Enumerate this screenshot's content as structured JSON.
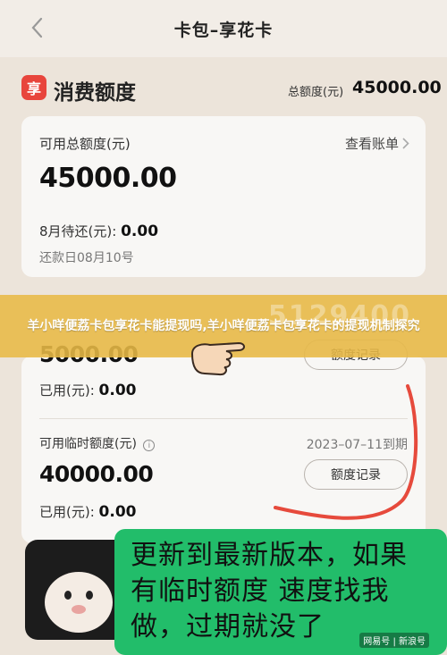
{
  "header": {
    "title": "卡包–享花卡"
  },
  "summary": {
    "brand_glyph": "享",
    "brand_title": "消费额度",
    "total_label": "总额度(元)",
    "total_value": "45000.00",
    "brand_color": "#e8453c"
  },
  "card1": {
    "available_label": "可用总额度(元)",
    "available_value": "45000.00",
    "view_bill": "查看账单",
    "due_label": "8月待还(元):",
    "due_value": "0.00",
    "due_date": "还款日08月10号"
  },
  "banner": {
    "text": "羊小咩便荔卡包享花卡能提现吗,羊小咩便荔卡包享花卡的提现机制探究",
    "ghost_number": "5129400"
  },
  "card2": {
    "fixed_value": "5000.00",
    "record_btn1": "额度记录",
    "used1_label": "已用(元):",
    "used1_value": "0.00",
    "temp_label": "可用临时额度(元)",
    "temp_expiry": "2023–07–11到期",
    "temp_value": "40000.00",
    "record_btn2": "额度记录",
    "used2_label": "已用(元):",
    "used2_value": "0.00"
  },
  "caption": {
    "line1": "更新到最新版本，如果",
    "line2": "有临时额度 速度找我",
    "line3": "做，过期就没了",
    "watermark": "网易号 | 新浪号",
    "color": "#22bd6a"
  }
}
